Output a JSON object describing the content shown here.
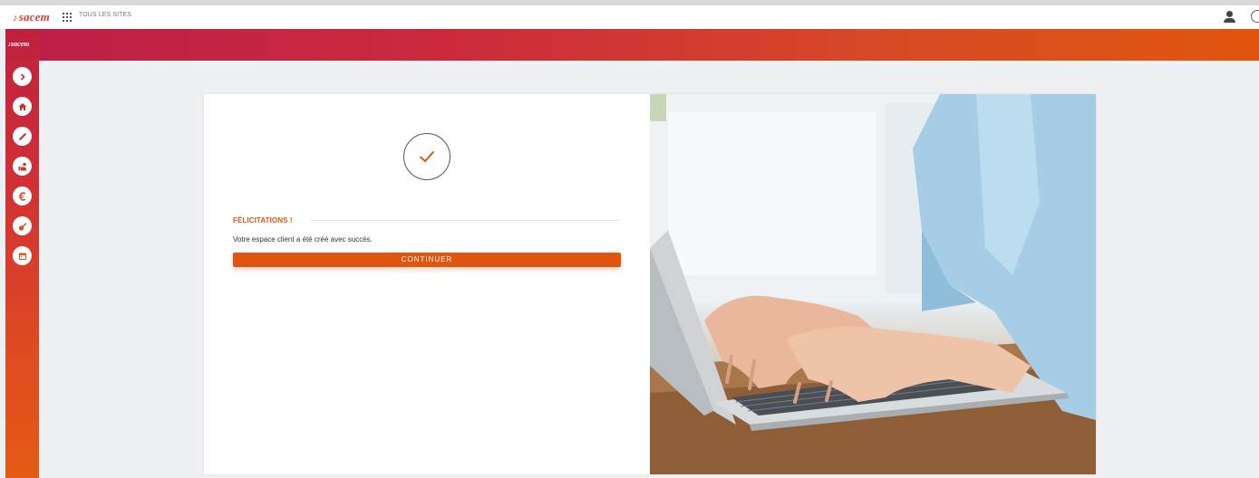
{
  "topbar": {
    "logo_text": "sacem",
    "sites_label": "TOUS LES SITES"
  },
  "sidebar": {
    "mini_logo": "sacem",
    "items": [
      {
        "icon": "chevron-right-icon"
      },
      {
        "icon": "home-icon"
      },
      {
        "icon": "pencil-icon"
      },
      {
        "icon": "hand-music-icon"
      },
      {
        "icon": "euro-icon"
      },
      {
        "icon": "guitar-icon"
      },
      {
        "icon": "calendar-icon"
      }
    ]
  },
  "colors": {
    "accent": "#e0560e",
    "brand_red": "#c0203e"
  },
  "main": {
    "section_title": "FÉLICITATIONS !",
    "message": "Votre espace client a été créé avec succès.",
    "continue_label": "CONTINUER"
  }
}
